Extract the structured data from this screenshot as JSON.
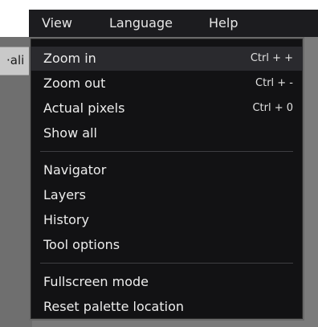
{
  "menubar": {
    "items": [
      {
        "label": "View"
      },
      {
        "label": "Language"
      },
      {
        "label": "Help"
      }
    ]
  },
  "background": {
    "toolbar_fragment_text": "·ali"
  },
  "view_menu": {
    "groups": [
      [
        {
          "label": "Zoom in",
          "shortcut": "Ctrl + +",
          "highlighted": true
        },
        {
          "label": "Zoom out",
          "shortcut": "Ctrl + -"
        },
        {
          "label": "Actual pixels",
          "shortcut": "Ctrl + 0"
        },
        {
          "label": "Show all",
          "shortcut": ""
        }
      ],
      [
        {
          "label": "Navigator",
          "shortcut": ""
        },
        {
          "label": "Layers",
          "shortcut": ""
        },
        {
          "label": "History",
          "shortcut": ""
        },
        {
          "label": "Tool options",
          "shortcut": ""
        }
      ],
      [
        {
          "label": "Fullscreen mode",
          "shortcut": ""
        },
        {
          "label": "Reset palette location",
          "shortcut": ""
        }
      ]
    ]
  },
  "colors": {
    "menu_bg": "#121214",
    "highlight": "#2a2a2e",
    "menubar_bg": "#1c1c1f",
    "text": "#ededed"
  }
}
